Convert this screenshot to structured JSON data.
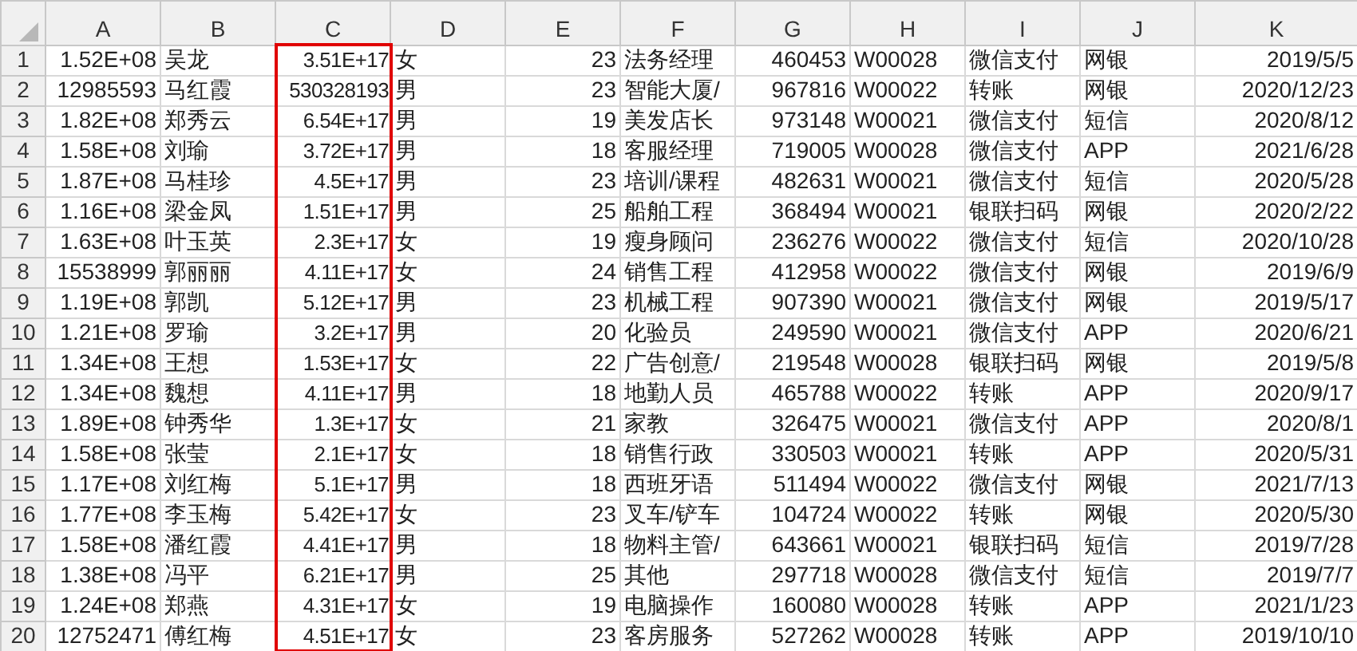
{
  "columns": [
    {
      "label": "A",
      "kind": "number",
      "highlighted": false
    },
    {
      "label": "B",
      "kind": "text",
      "highlighted": false
    },
    {
      "label": "C",
      "kind": "number",
      "highlighted": true
    },
    {
      "label": "D",
      "kind": "text",
      "highlighted": false
    },
    {
      "label": "E",
      "kind": "number",
      "highlighted": false
    },
    {
      "label": "F",
      "kind": "text",
      "highlighted": false
    },
    {
      "label": "G",
      "kind": "number",
      "highlighted": false
    },
    {
      "label": "H",
      "kind": "text",
      "highlighted": false
    },
    {
      "label": "I",
      "kind": "text",
      "highlighted": false
    },
    {
      "label": "J",
      "kind": "text",
      "highlighted": false
    },
    {
      "label": "K",
      "kind": "number",
      "highlighted": false
    }
  ],
  "rows": [
    {
      "number": "1",
      "cells": [
        "1.52E+08",
        "吴龙",
        "3.51E+17",
        "女",
        "23",
        "法务经理",
        "460453",
        "W00028",
        "微信支付",
        "网银",
        "2019/5/5"
      ]
    },
    {
      "number": "2",
      "cells": [
        "12985593",
        "马红霞",
        "530328193",
        "男",
        "23",
        "智能大厦/",
        "967816",
        "W00022",
        "转账",
        "网银",
        "2020/12/23"
      ]
    },
    {
      "number": "3",
      "cells": [
        "1.82E+08",
        "郑秀云",
        "6.54E+17",
        "男",
        "19",
        "美发店长",
        "973148",
        "W00021",
        "微信支付",
        "短信",
        "2020/8/12"
      ]
    },
    {
      "number": "4",
      "cells": [
        "1.58E+08",
        "刘瑜",
        "3.72E+17",
        "男",
        "18",
        "客服经理",
        "719005",
        "W00028",
        "微信支付",
        "APP",
        "2021/6/28"
      ]
    },
    {
      "number": "5",
      "cells": [
        "1.87E+08",
        "马桂珍",
        "4.5E+17",
        "男",
        "23",
        "培训/课程",
        "482631",
        "W00021",
        "微信支付",
        "短信",
        "2020/5/28"
      ]
    },
    {
      "number": "6",
      "cells": [
        "1.16E+08",
        "梁金凤",
        "1.51E+17",
        "男",
        "25",
        "船舶工程",
        "368494",
        "W00021",
        "银联扫码",
        "网银",
        "2020/2/22"
      ]
    },
    {
      "number": "7",
      "cells": [
        "1.63E+08",
        "叶玉英",
        "2.3E+17",
        "女",
        "19",
        "瘦身顾问",
        "236276",
        "W00022",
        "微信支付",
        "短信",
        "2020/10/28"
      ]
    },
    {
      "number": "8",
      "cells": [
        "15538999",
        "郭丽丽",
        "4.11E+17",
        "女",
        "24",
        "销售工程",
        "412958",
        "W00022",
        "微信支付",
        "网银",
        "2019/6/9"
      ]
    },
    {
      "number": "9",
      "cells": [
        "1.19E+08",
        "郭凯",
        "5.12E+17",
        "男",
        "23",
        "机械工程",
        "907390",
        "W00021",
        "微信支付",
        "网银",
        "2019/5/17"
      ]
    },
    {
      "number": "10",
      "cells": [
        "1.21E+08",
        "罗瑜",
        "3.2E+17",
        "男",
        "20",
        "化验员",
        "249590",
        "W00021",
        "微信支付",
        "APP",
        "2020/6/21"
      ]
    },
    {
      "number": "11",
      "cells": [
        "1.34E+08",
        "王想",
        "1.53E+17",
        "女",
        "22",
        "广告创意/",
        "219548",
        "W00028",
        "银联扫码",
        "网银",
        "2019/5/8"
      ]
    },
    {
      "number": "12",
      "cells": [
        "1.34E+08",
        "魏想",
        "4.11E+17",
        "男",
        "18",
        "地勤人员",
        "465788",
        "W00022",
        "转账",
        "APP",
        "2020/9/17"
      ]
    },
    {
      "number": "13",
      "cells": [
        "1.89E+08",
        "钟秀华",
        "1.3E+17",
        "女",
        "21",
        "家教",
        "326475",
        "W00021",
        "微信支付",
        "APP",
        "2020/8/1"
      ]
    },
    {
      "number": "14",
      "cells": [
        "1.58E+08",
        "张莹",
        "2.1E+17",
        "女",
        "18",
        "销售行政",
        "330503",
        "W00021",
        "转账",
        "APP",
        "2020/5/31"
      ]
    },
    {
      "number": "15",
      "cells": [
        "1.17E+08",
        "刘红梅",
        "5.1E+17",
        "男",
        "18",
        "西班牙语",
        "511494",
        "W00022",
        "微信支付",
        "网银",
        "2021/7/13"
      ]
    },
    {
      "number": "16",
      "cells": [
        "1.77E+08",
        "李玉梅",
        "5.42E+17",
        "女",
        "23",
        "叉车/铲车",
        "104724",
        "W00022",
        "转账",
        "网银",
        "2020/5/30"
      ]
    },
    {
      "number": "17",
      "cells": [
        "1.58E+08",
        "潘红霞",
        "4.41E+17",
        "男",
        "18",
        "物料主管/",
        "643661",
        "W00021",
        "银联扫码",
        "短信",
        "2019/7/28"
      ]
    },
    {
      "number": "18",
      "cells": [
        "1.38E+08",
        "冯平",
        "6.21E+17",
        "男",
        "25",
        "其他",
        "297718",
        "W00028",
        "微信支付",
        "短信",
        "2019/7/7"
      ]
    },
    {
      "number": "19",
      "cells": [
        "1.24E+08",
        "郑燕",
        "4.31E+17",
        "女",
        "19",
        "电脑操作",
        "160080",
        "W00028",
        "转账",
        "APP",
        "2021/1/23"
      ]
    },
    {
      "number": "20",
      "cells": [
        "12752471",
        "傅红梅",
        "4.51E+17",
        "女",
        "23",
        "客房服务",
        "527262",
        "W00028",
        "转账",
        "APP",
        "2019/10/10"
      ]
    }
  ]
}
